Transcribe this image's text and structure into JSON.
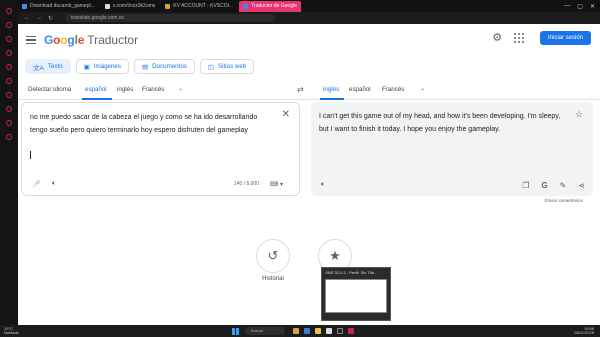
{
  "browser": {
    "tabs": [
      {
        "label": "Download ducamb_gamepl..."
      },
      {
        "label": "x.com/i/nzz3k2oms"
      },
      {
        "label": "KV ACCOUNT - KVSCOI..."
      },
      {
        "label": "Traductor de Google",
        "active": true
      }
    ],
    "url": "translate.google.com.ec"
  },
  "header": {
    "logo": "Google",
    "product": "Traductor",
    "signin_label": "Iniciar sesión"
  },
  "modes": [
    {
      "icon": "translate-icon",
      "label": "Texto"
    },
    {
      "icon": "image-icon",
      "label": "Imágenes"
    },
    {
      "icon": "document-icon",
      "label": "Documentos"
    },
    {
      "icon": "web-icon",
      "label": "Sitios web"
    }
  ],
  "source_langs": [
    "Detectar idioma",
    "español",
    "inglés",
    "Francés"
  ],
  "target_langs": [
    "inglés",
    "español",
    "Francés"
  ],
  "source": {
    "text": "no me puedo sacar de la cabeza el juego y como se ha ido desarrollando tengo sueño pero quiero terminarlo hoy espero disfruten del gameplay",
    "char_count": "140 / 5.000"
  },
  "target": {
    "text": "I can't get this game out of my head, and how it's been developing. I'm sleepy, but I want to finish it today. I hope you enjoy the gameplay."
  },
  "feedback_label": "Enviar comentarios",
  "history": {
    "label": "Historial"
  },
  "preview": {
    "title": "OBS 32.0.2 - Perfil: Sin Títu..."
  },
  "taskbar": {
    "weather_temp": "19°C",
    "weather_desc": "Nublado",
    "search_placeholder": "Buscar",
    "time": "19:59",
    "date": "08/11/2025"
  },
  "colors": {
    "accent": "#1a73e8",
    "tab_active": "#e8356f"
  }
}
